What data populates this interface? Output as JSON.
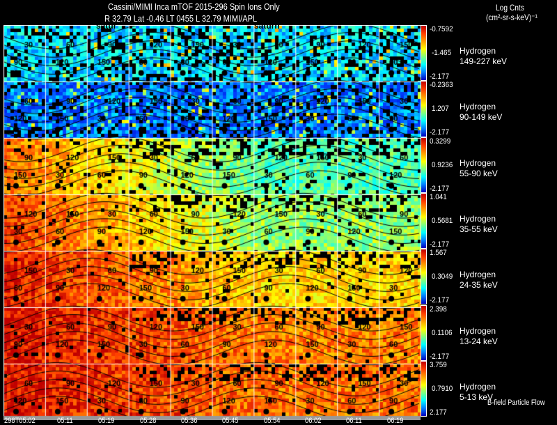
{
  "header": {
    "title": "Cassini/MIMI Inca mTOF  2015-296   Spin   Ions Only",
    "subtitle": "R        32.79 Lat -0.46 LT 0455 L          32.79  MIMI/APL",
    "units_title": "Log Cnts",
    "units": "(cm²-sr-s-keV)⁻¹"
  },
  "overlay_labels": [
    "satur",
    "saturn"
  ],
  "panels": [
    {
      "species": "Hydrogen",
      "energy": "149-227 keV",
      "cb_max": "-0.7592",
      "cb_mid": "-1.465",
      "cb_min": "-2.177"
    },
    {
      "species": "Hydrogen",
      "energy": "90-149 keV",
      "cb_max": "-0.2363",
      "cb_mid": "1.207",
      "cb_min": "-2.177"
    },
    {
      "species": "Hydrogen",
      "energy": "55-90 keV",
      "cb_max": "0.3299",
      "cb_mid": "0.9236",
      "cb_min": "-2.177"
    },
    {
      "species": "Hydrogen",
      "energy": "35-55 keV",
      "cb_max": "1.041",
      "cb_mid": "0.5681",
      "cb_min": "-2.177"
    },
    {
      "species": "Hydrogen",
      "energy": "24-35 keV",
      "cb_max": "1.567",
      "cb_mid": "0.3049",
      "cb_min": "-2.177"
    },
    {
      "species": "Hydrogen",
      "energy": "13-24 keV",
      "cb_max": "2.398",
      "cb_mid": "0.1106",
      "cb_min": "-2.177"
    },
    {
      "species": "Hydrogen",
      "energy": "5-13 keV",
      "cb_max": "3.759",
      "cb_mid": "0.7910",
      "cb_min": "2.177"
    }
  ],
  "contour_levels": [
    "30",
    "60",
    "90",
    "120",
    "150"
  ],
  "time_labels": [
    "298T05:02",
    "05:11",
    "05:19",
    "05:28",
    "05:36",
    "05:45",
    "05:54",
    "06:02",
    "06:11",
    "06:19"
  ],
  "legend_note": "B-field Particle Flow",
  "colormap": [
    "#c00000",
    "#ff4000",
    "#ffa000",
    "#ffff00",
    "#80ff80",
    "#00ffff",
    "#0080ff",
    "#0000c0"
  ]
}
